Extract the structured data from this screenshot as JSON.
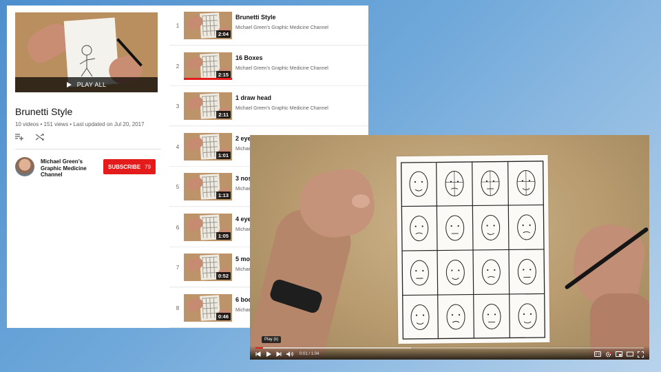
{
  "playlist": {
    "play_all_label": "PLAY ALL",
    "title": "Brunetti Style",
    "video_count": "10 videos",
    "views": "151 views",
    "last_updated": "Last updated on Jul 20, 2017",
    "owner": "Michael Green's Graphic Medicine Channel",
    "subscribe_label": "SUBSCRIBE",
    "subscriber_count": "79"
  },
  "videos": [
    {
      "index": "1",
      "title": "Brunetti Style",
      "channel": "Michael Green's Graphic Medicine Channel",
      "duration": "2:04",
      "watched_fraction": 0
    },
    {
      "index": "2",
      "title": "16 Boxes",
      "channel": "Michael Green's Graphic Medicine Channel",
      "duration": "2:15",
      "watched_fraction": 1
    },
    {
      "index": "3",
      "title": "1 draw head",
      "channel": "Michael Green's Graphic Medicine Channel",
      "duration": "2:11",
      "watched_fraction": 0
    },
    {
      "index": "4",
      "title": "2 eye",
      "channel": "Michae",
      "duration": "1:01",
      "watched_fraction": 0
    },
    {
      "index": "5",
      "title": "3 nos",
      "channel": "Michae",
      "duration": "1:13",
      "watched_fraction": 0
    },
    {
      "index": "6",
      "title": "4 eye",
      "channel": "Michae",
      "duration": "1:05",
      "watched_fraction": 0
    },
    {
      "index": "7",
      "title": "5 mo",
      "channel": "Michae",
      "duration": "0:52",
      "watched_fraction": 0
    },
    {
      "index": "8",
      "title": "6 bod",
      "channel": "Michae",
      "duration": "0:46",
      "watched_fraction": 0
    }
  ],
  "player": {
    "tooltip": "Play (k)",
    "current_time": "0:01",
    "total_time": "1:04",
    "played_fraction": 0.02,
    "loaded_fraction": 0.4
  },
  "icons": {
    "add_to_queue": "add-to-queue-icon",
    "shuffle": "shuffle-icon",
    "previous": "previous-icon",
    "play": "play-icon",
    "next": "next-icon",
    "volume": "volume-icon",
    "captions": "captions-icon",
    "settings": "settings-icon",
    "miniplayer": "miniplayer-icon",
    "theater": "theater-mode-icon",
    "fullscreen": "fullscreen-icon"
  },
  "colors": {
    "accent_red": "#e31b1b",
    "background_blue": "#4d8fce"
  }
}
